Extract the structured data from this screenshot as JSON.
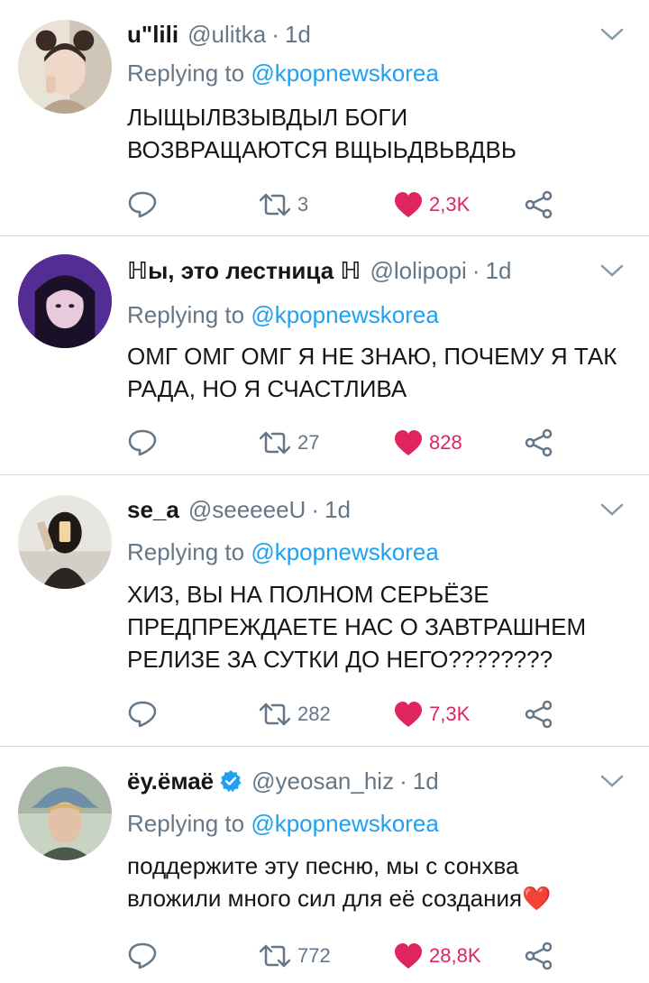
{
  "reply_prefix": "Replying to",
  "tweets": [
    {
      "name": "u\"lili",
      "handle": "@ulitka",
      "time": "1d",
      "mention": "@kpopnewskorea",
      "text_lines": [
        "ЛЫЩЫЛВЗЫВДЫЛ БОГИ",
        "ВОЗВРАЩАЮТСЯ ВЩЫЬДВЬВДВЬ"
      ],
      "retweets": "3",
      "likes": "2,3K"
    },
    {
      "name": "ℍы, это лестница ℍ",
      "handle": "@lolipopi",
      "time": "1d",
      "mention": "@kpopnewskorea",
      "text_lines": [
        "ОМГ ОМГ ОМГ Я НЕ ЗНАЮ, ПОЧЕМУ Я ТАК",
        "РАДА, НО Я СЧАСТЛИВА"
      ],
      "retweets": "27",
      "likes": "828"
    },
    {
      "name": "se_a",
      "handle": "@seeeeeU",
      "time": "1d",
      "mention": "@kpopnewskorea",
      "text_lines": [
        "ХИЗ, ВЫ НА ПОЛНОМ СЕРЬЁЗЕ",
        "ПРЕДПРЕЖДАЕТЕ НАС О ЗАВТРАШНЕМ",
        "РЕЛИЗЕ ЗА СУТКИ ДО НЕГО????????"
      ],
      "retweets": "282",
      "likes": "7,3K"
    },
    {
      "name": "ёу.ёмаё",
      "handle": "@yeosan_hiz",
      "time": "1d",
      "mention": "@kpopnewskorea",
      "text_lines": [
        "поддержите эту песню, мы с сонхва",
        "вложили много сил для её создания"
      ],
      "text_emoji": "❤️",
      "retweets": "772",
      "likes": "28,8K",
      "verified": true
    }
  ],
  "colors": {
    "link": "#1da1f2",
    "muted": "#657786",
    "like": "#e0245e",
    "divider": "#d9d9d9"
  }
}
